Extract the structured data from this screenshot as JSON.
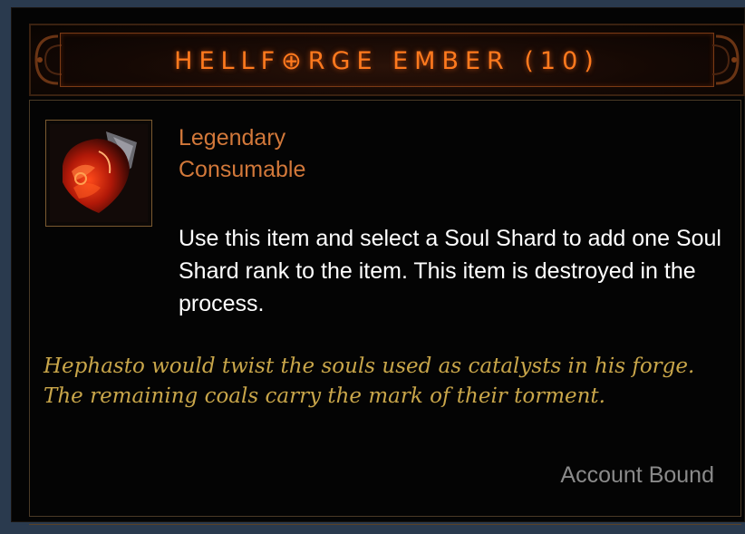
{
  "tooltip": {
    "title": "HELLF⊕RGE EMBER (10)",
    "icon": "hellforge-ember-icon",
    "rarity": "Legendary",
    "type": "Consumable",
    "description": "Use this item and select a Soul Shard to add one Soul Shard rank to the item. This item is destroyed in the process.",
    "flavor": "Hephasto would twist the souls used as catalysts in his forge. The remaining coals carry the mark of their torment.",
    "binding": "Account Bound"
  },
  "colors": {
    "title": "#ff7a1e",
    "rarity": "#d2783a",
    "flavor": "#c9a64a",
    "binding": "#8a8a8a"
  }
}
